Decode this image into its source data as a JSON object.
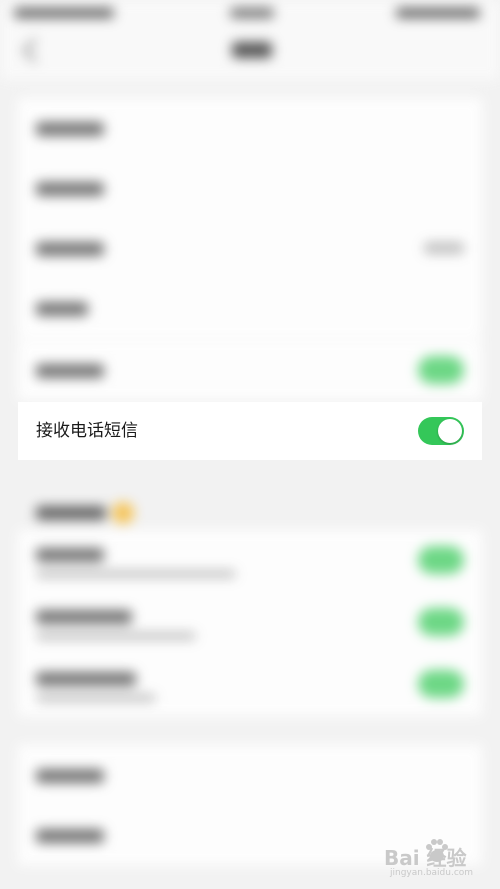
{
  "setting": {
    "label": "接收电话短信",
    "enabled": true
  },
  "colors": {
    "toggle_on": "#34c759",
    "background": "#f2f2f2",
    "row_background": "#ffffff",
    "text": "#1a1a1a"
  },
  "watermark": {
    "brand": "Bai  经验",
    "url": "jingyan.baidu.com",
    "icon": "paw-icon"
  }
}
